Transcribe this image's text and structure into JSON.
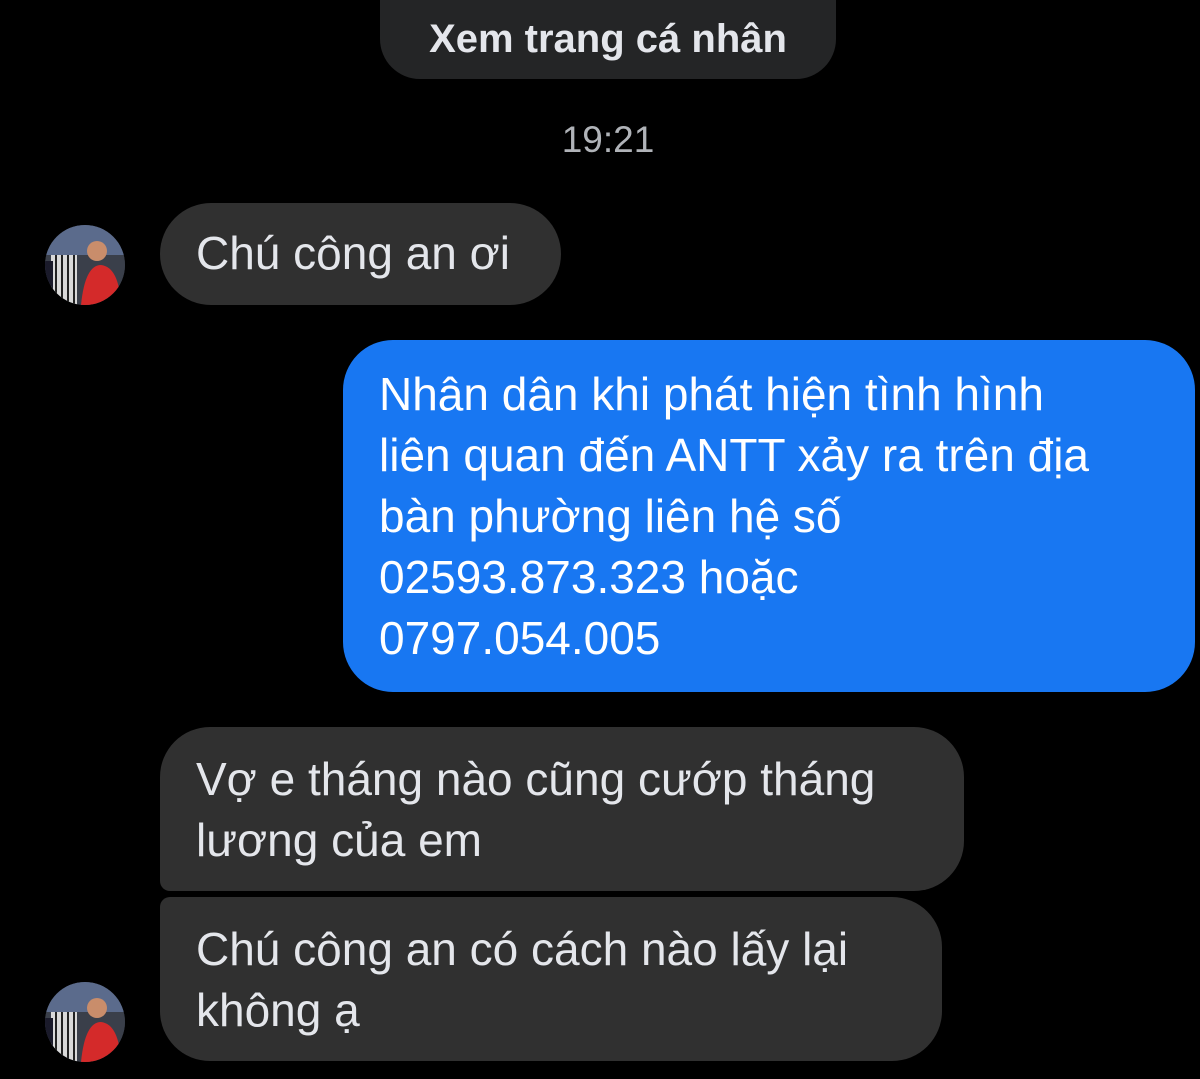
{
  "header": {
    "view_profile_label": "Xem trang cá nhân"
  },
  "conversation": {
    "timestamp": "19:21",
    "messages": [
      {
        "direction": "incoming",
        "text": "Chú công an ơi"
      },
      {
        "direction": "outgoing",
        "text": "Nhân dân khi phát hiện tình hình\nliên quan đến ANTT xảy ra trên địa\nbàn phường liên hệ số\n02593.873.323 hoặc\n0797.054.005"
      },
      {
        "direction": "incoming",
        "text": "Vợ e tháng nào cũng cướp tháng\nlương của em"
      },
      {
        "direction": "incoming",
        "text": "Chú công an có cách nào lấy lại\nkhông ạ"
      }
    ]
  },
  "colors": {
    "background": "#000000",
    "incoming_bubble": "#303030",
    "outgoing_bubble": "#1877f2",
    "pill": "#242526",
    "timestamp": "#b0b3b8"
  },
  "icons": {
    "avatar": "contact-avatar-icon"
  }
}
